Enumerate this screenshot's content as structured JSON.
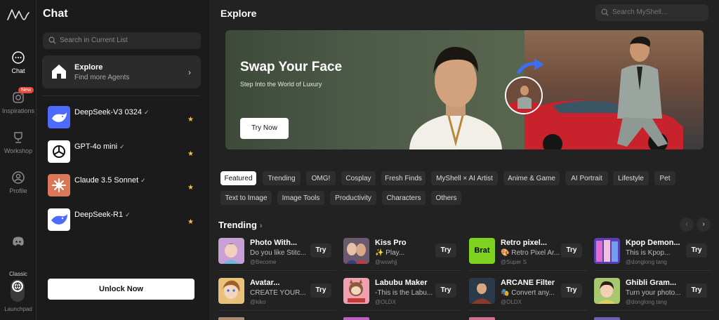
{
  "rail": {
    "items": [
      {
        "label": "Chat",
        "icon": "chat-bubble-icon"
      },
      {
        "label": "Inspirations",
        "icon": "instagram-icon",
        "badge": "New"
      },
      {
        "label": "Workshop",
        "icon": "trophy-icon"
      },
      {
        "label": "Profile",
        "icon": "user-icon"
      }
    ],
    "discord_icon": "discord-icon",
    "classic_label": "Classic",
    "launchpad_label": "Launchpad"
  },
  "chat": {
    "title": "Chat",
    "search_placeholder": "Search in Current List",
    "explore": {
      "title": "Explore",
      "subtitle": "Find more Agents"
    },
    "agents": [
      {
        "name": "DeepSeek-V3 0324",
        "verified": "✓"
      },
      {
        "name": "GPT-4o mini",
        "verified": "✓"
      },
      {
        "name": "Claude 3.5 Sonnet",
        "verified": "✓"
      },
      {
        "name": "DeepSeek-R1",
        "verified": "✓"
      }
    ],
    "unlock_label": "Unlock Now"
  },
  "main": {
    "title": "Explore",
    "search_placeholder": "Search MyShell...",
    "banner": {
      "title": "Swap Your Face",
      "subtitle": "Step Into the World of Luxury",
      "cta": "Try Now"
    },
    "tags": [
      "Featured",
      "Trending",
      "OMG!",
      "Cosplay",
      "Fresh Finds",
      "MyShell × AI Artist",
      "Anime & Game",
      "AI Portrait",
      "Lifestyle",
      "Pet",
      "Text to Image",
      "Image Tools",
      "Productivity",
      "Characters",
      "Others"
    ],
    "section_title": "Trending",
    "try_label": "Try",
    "cards": [
      {
        "title": "Photo With...",
        "desc": "Do you like Stitc...",
        "author": "@Become"
      },
      {
        "title": "Kiss Pro",
        "desc": "✨ Play...",
        "author": "@wxwhjj"
      },
      {
        "title": "Retro pixel...",
        "desc": "🎨 Retro Pixel Ar...",
        "author": "@Super S"
      },
      {
        "title": "Kpop Demon...",
        "desc": "This is Kpop...",
        "author": "@donglong tang"
      },
      {
        "title": "Avatar...",
        "desc": "CREATE YOUR...",
        "author": "@kiko"
      },
      {
        "title": "Labubu Maker",
        "desc": "-This is the Labu...",
        "author": "@OLDX"
      },
      {
        "title": "ARCANE Filter",
        "desc": "🎭 Convert any...",
        "author": "@OLDX"
      },
      {
        "title": "Ghibli Gram...",
        "desc": "Turn your photo...",
        "author": "@donglong tang"
      }
    ],
    "thumb_texts": {
      "retro": "Brat",
      "labubu": "LABUBU"
    }
  }
}
